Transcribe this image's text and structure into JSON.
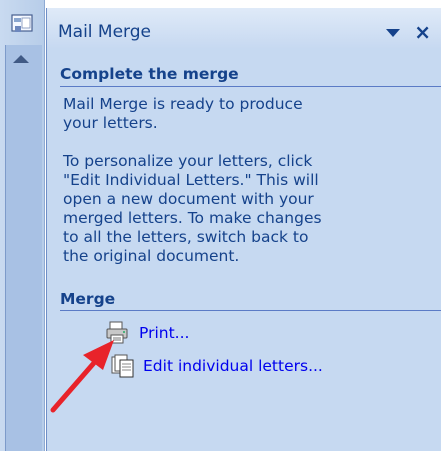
{
  "pane": {
    "title": "Mail Merge",
    "menu_icon": "chevron-down-icon",
    "close_label": "×"
  },
  "complete": {
    "heading": "Complete the merge",
    "para1": [
      "Mail Merge is ready to produce",
      "your letters."
    ],
    "para2": [
      "To personalize your letters, click",
      "\"Edit Individual Letters.\" This will",
      "open a new document with your",
      "merged letters. To make changes",
      "to all the letters, switch back to",
      "the original document."
    ]
  },
  "merge": {
    "heading": "Merge",
    "print_label": "Print...",
    "edit_label": "Edit individual letters..."
  },
  "colors": {
    "pane_bg": "#c6d9f1",
    "heading": "#15428b",
    "link": "#0000ee",
    "arrow": "#e8232a"
  }
}
